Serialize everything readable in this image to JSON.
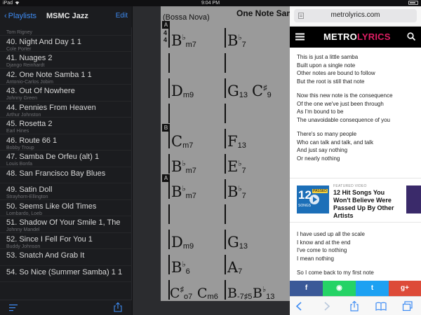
{
  "status_bar": {
    "device": "iPad",
    "time": "9:04 PM"
  },
  "playlist": {
    "back_label": "Playlists",
    "title": "MSMC Jazz",
    "edit_label": "Edit",
    "partial_top_composer": "Tom Rigney",
    "items": [
      {
        "title": "40. Night And Day 1 1",
        "composer": "Cole Porter"
      },
      {
        "title": "41. Nuages 2",
        "composer": "Django Reinhardt"
      },
      {
        "title": "42. One Note Samba 1 1",
        "composer": "Antonio-Carlos Jobim"
      },
      {
        "title": "43. Out Of Nowhere",
        "composer": "Johnny Green"
      },
      {
        "title": "44. Pennies From Heaven",
        "composer": "Arthur Johnston"
      },
      {
        "title": "45. Rosetta 2",
        "composer": "Earl Hines"
      },
      {
        "title": "46. Route 66 1",
        "composer": "Bobby Troup"
      },
      {
        "title": "47. Samba De Orfeu (alt) 1",
        "composer": "Louis Bonfa"
      },
      {
        "title": "48. San Francisco Bay Blues",
        "composer": ""
      },
      {
        "title": "49. Satin Doll",
        "composer": "Strayhorn-Ellington"
      },
      {
        "title": "50. Seems Like Old Times",
        "composer": "Lombardo, Loeb"
      },
      {
        "title": "51. Shadow Of Your Smile 1, The",
        "composer": "Johnny Mandel"
      },
      {
        "title": "52. Since I Fell For You 1",
        "composer": "Buddy Johnson"
      },
      {
        "title": "53. Snatch And Grab It",
        "composer": ""
      },
      {
        "title": "54. So Nice (Summer Samba) 1 1",
        "composer": ""
      }
    ]
  },
  "sheet": {
    "style": "(Bossa Nova)",
    "song_title": "One Note Samba",
    "section_a": "A",
    "section_b": "B",
    "time_top": "4",
    "time_bottom": "4",
    "chords": {
      "r1": [
        {
          "root": "B",
          "acc": "♭",
          "qual": "m7"
        },
        {
          "root": "B",
          "acc": "♭",
          "qual": "7"
        }
      ],
      "r2": [
        {
          "root": "D",
          "acc": "",
          "qual": "m9"
        },
        {
          "root": "G",
          "acc": "",
          "qual": "13"
        }
      ],
      "r2extra": {
        "root": "C",
        "acc": "♯",
        "qual": "9"
      },
      "r3": [
        {
          "root": "C",
          "acc": "",
          "qual": "m7"
        },
        {
          "root": "F",
          "acc": "",
          "qual": "13"
        }
      ],
      "r4": [
        {
          "root": "B",
          "acc": "♭",
          "qual": "m7"
        },
        {
          "root": "E",
          "acc": "♭",
          "qual": "7"
        }
      ],
      "r5": [
        {
          "root": "B",
          "acc": "♭",
          "qual": "m7"
        },
        {
          "root": "B",
          "acc": "♭",
          "qual": "7"
        }
      ],
      "r6": [
        {
          "root": "D",
          "acc": "",
          "qual": "m9"
        },
        {
          "root": "G",
          "acc": "",
          "qual": "13"
        }
      ],
      "r7": [
        {
          "root": "B",
          "acc": "♭",
          "qual": "6"
        },
        {
          "root": "A",
          "acc": "",
          "qual": "7"
        }
      ],
      "r8": [
        {
          "root": "C",
          "acc": "♯",
          "qual": "o7"
        },
        {
          "root": "C",
          "acc": "",
          "qual": "m6"
        },
        {
          "root": "B",
          "acc": "",
          "qual": "-7♯5"
        },
        {
          "root": "B",
          "acc": "♭",
          "qual": "13"
        }
      ]
    }
  },
  "browser": {
    "url": "metrolyrics.com",
    "logo_part1": "METRO",
    "logo_part2": "LYRICS",
    "verse1": [
      "This is just a little samba",
      "Built upon a single note",
      "Other notes are bound to follow",
      "But the root is still that note"
    ],
    "verse2": [
      "Now this new note is the consequence",
      "Of the one we've just been through",
      "As I'm bound to be",
      "The unavoidable consequence of you"
    ],
    "verse3": [
      "There's so many people",
      "Who can talk and talk, and talk",
      "And just say nothing",
      "Or nearly nothing"
    ],
    "verse4": [
      "I have used up all the scale",
      "I know and at the end",
      "I've come to nothing",
      "I mean nothing"
    ],
    "verse5_partial": "So I come back to my first note",
    "promo": {
      "tag": "FEATURED VIDEO",
      "headline": "12 Hit Songs You Won't Believe Were Passed Up By Other Artists",
      "thumb_number": "12",
      "thumb_badge": "PASSED",
      "thumb_caption": "SONGS"
    },
    "share": [
      {
        "label": "f",
        "color": "#3b5998"
      },
      {
        "label": "◉",
        "color": "#25d366"
      },
      {
        "label": "t",
        "color": "#1da1f2"
      },
      {
        "label": "g+",
        "color": "#dd4b39"
      }
    ]
  }
}
